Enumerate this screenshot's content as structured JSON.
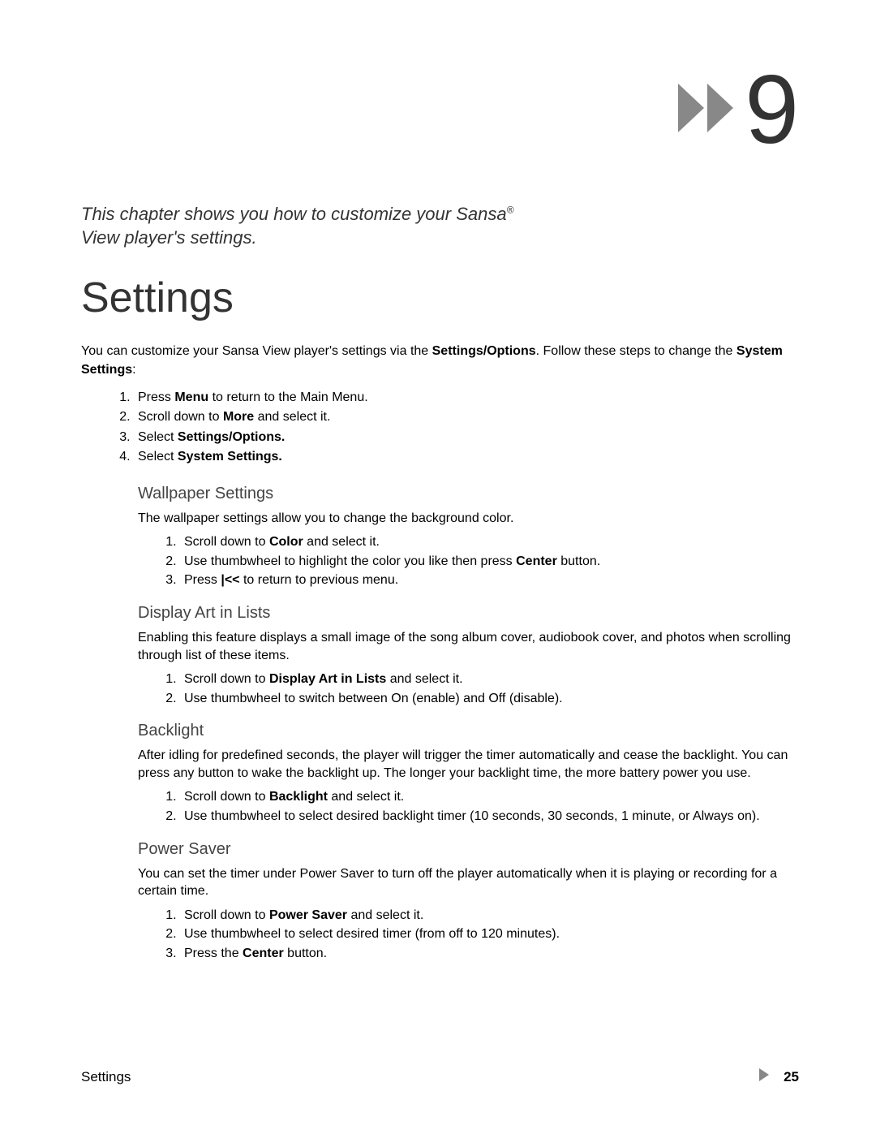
{
  "chapter_number": "9",
  "chapter_intro_1": "This chapter shows you how to customize your Sansa",
  "chapter_intro_sup": "®",
  "chapter_intro_2": "View player's settings.",
  "chapter_title": "Settings",
  "intro_text_1": "You can customize your Sansa View player's settings via the ",
  "intro_bold_1": "Settings/Options",
  "intro_text_2": ".  Follow these steps to change the ",
  "intro_bold_2": "System Settings",
  "intro_text_3": ":",
  "main_steps": {
    "s1_a": "Press ",
    "s1_b": "Menu",
    "s1_c": " to return to the Main Menu.",
    "s2_a": "Scroll down to ",
    "s2_b": "More",
    "s2_c": " and select it.",
    "s3_a": "Select ",
    "s3_b": "Settings/Options.",
    "s4_a": "Select ",
    "s4_b": "System Settings."
  },
  "wallpaper": {
    "title": "Wallpaper Settings",
    "text": "The wallpaper settings allow you to change the background color.",
    "s1_a": "Scroll down to ",
    "s1_b": "Color",
    "s1_c": " and select it.",
    "s2_a": "Use thumbwheel to highlight the color you like then press ",
    "s2_b": "Center",
    "s2_c": " button.",
    "s3_a": "Press ",
    "s3_b": "|<<",
    "s3_c": " to return to previous menu."
  },
  "display_art": {
    "title": "Display Art in Lists",
    "text": "Enabling this feature displays a small image of the song album cover, audiobook cover, and photos when scrolling through list of these items.",
    "s1_a": "Scroll down to ",
    "s1_b": "Display Art in Lists",
    "s1_c": " and select it.",
    "s2": "Use thumbwheel to switch between On (enable) and Off (disable)."
  },
  "backlight": {
    "title": "Backlight",
    "text": "After idling for predefined seconds, the player will trigger the timer automatically and cease the backlight.  You can press any button to wake the backlight up.  The longer your backlight time, the more battery power you use.",
    "s1_a": "Scroll down to ",
    "s1_b": "Backlight",
    "s1_c": " and select it.",
    "s2": "Use thumbwheel to select desired backlight timer (10 seconds, 30 seconds, 1 minute, or Always on)."
  },
  "power_saver": {
    "title": "Power Saver",
    "text": "You can set the timer under Power Saver to turn off the player automatically when it is playing or recording for a certain time.",
    "s1_a": "Scroll down to ",
    "s1_b": "Power Saver",
    "s1_c": " and select it.",
    "s2": "Use thumbwheel to select desired timer (from off to 120 minutes).",
    "s3_a": "Press the ",
    "s3_b": "Center",
    "s3_c": " button."
  },
  "footer_label": "Settings",
  "page_number": "25"
}
